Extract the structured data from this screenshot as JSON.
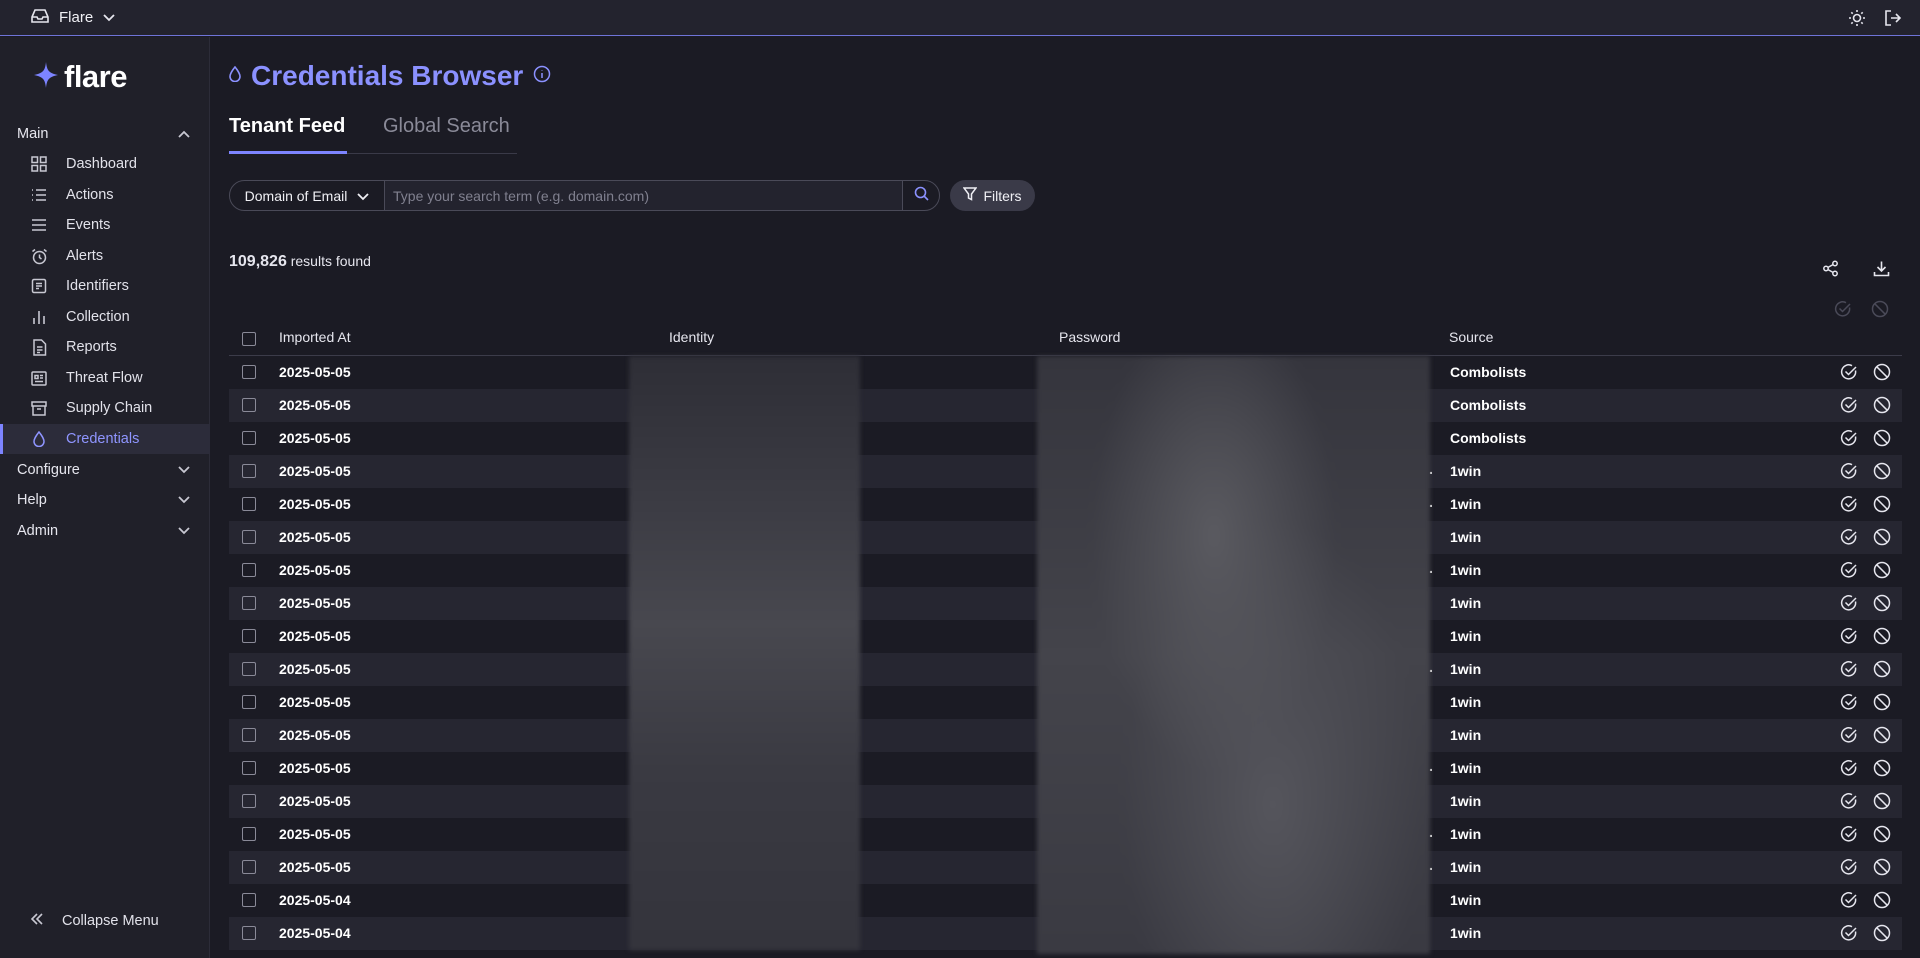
{
  "topbar": {
    "org_name": "Flare"
  },
  "sidebar": {
    "logo_text": "flare",
    "main_section": "Main",
    "items": [
      {
        "label": "Dashboard",
        "icon": "grid-icon"
      },
      {
        "label": "Actions",
        "icon": "list-icon"
      },
      {
        "label": "Events",
        "icon": "menu-lines-icon"
      },
      {
        "label": "Alerts",
        "icon": "alarm-clock-icon"
      },
      {
        "label": "Identifiers",
        "icon": "id-card-icon"
      },
      {
        "label": "Collection",
        "icon": "bar-chart-icon"
      },
      {
        "label": "Reports",
        "icon": "document-icon"
      },
      {
        "label": "Threat Flow",
        "icon": "newspaper-icon"
      },
      {
        "label": "Supply Chain",
        "icon": "archive-box-icon"
      },
      {
        "label": "Credentials",
        "icon": "drop-icon",
        "active": true
      }
    ],
    "sections": [
      "Configure",
      "Help",
      "Admin"
    ],
    "collapse_label": "Collapse Menu"
  },
  "page": {
    "title": "Credentials Browser",
    "tabs": [
      "Tenant Feed",
      "Global Search"
    ]
  },
  "search": {
    "field_select": "Domain of Email",
    "placeholder": "Type your search term (e.g. domain.com)",
    "filters_label": "Filters"
  },
  "results": {
    "count": "109,826",
    "suffix": " results found"
  },
  "table": {
    "columns": [
      "Imported At",
      "Identity",
      "Password",
      "Source"
    ],
    "rows": [
      {
        "date": "2025-05-05",
        "source": "Combolists",
        "trunc": false
      },
      {
        "date": "2025-05-05",
        "source": "Combolists",
        "trunc": false
      },
      {
        "date": "2025-05-05",
        "source": "Combolists",
        "trunc": false
      },
      {
        "date": "2025-05-05",
        "source": "1win",
        "trunc": true
      },
      {
        "date": "2025-05-05",
        "source": "1win",
        "trunc": true
      },
      {
        "date": "2025-05-05",
        "source": "1win",
        "trunc": false
      },
      {
        "date": "2025-05-05",
        "source": "1win",
        "trunc": true
      },
      {
        "date": "2025-05-05",
        "source": "1win",
        "trunc": false
      },
      {
        "date": "2025-05-05",
        "source": "1win",
        "trunc": false
      },
      {
        "date": "2025-05-05",
        "source": "1win",
        "trunc": true
      },
      {
        "date": "2025-05-05",
        "source": "1win",
        "trunc": false
      },
      {
        "date": "2025-05-05",
        "source": "1win",
        "trunc": false
      },
      {
        "date": "2025-05-05",
        "source": "1win",
        "trunc": true
      },
      {
        "date": "2025-05-05",
        "source": "1win",
        "trunc": false
      },
      {
        "date": "2025-05-05",
        "source": "1win",
        "trunc": true
      },
      {
        "date": "2025-05-05",
        "source": "1win",
        "trunc": true
      },
      {
        "date": "2025-05-04",
        "source": "1win",
        "trunc": false
      },
      {
        "date": "2025-05-04",
        "source": "1win",
        "trunc": false
      }
    ]
  },
  "colors": {
    "accent": "#7d84ff",
    "title": "#8b91ff",
    "background": "#1b1b24",
    "sidebar": "#202029"
  }
}
